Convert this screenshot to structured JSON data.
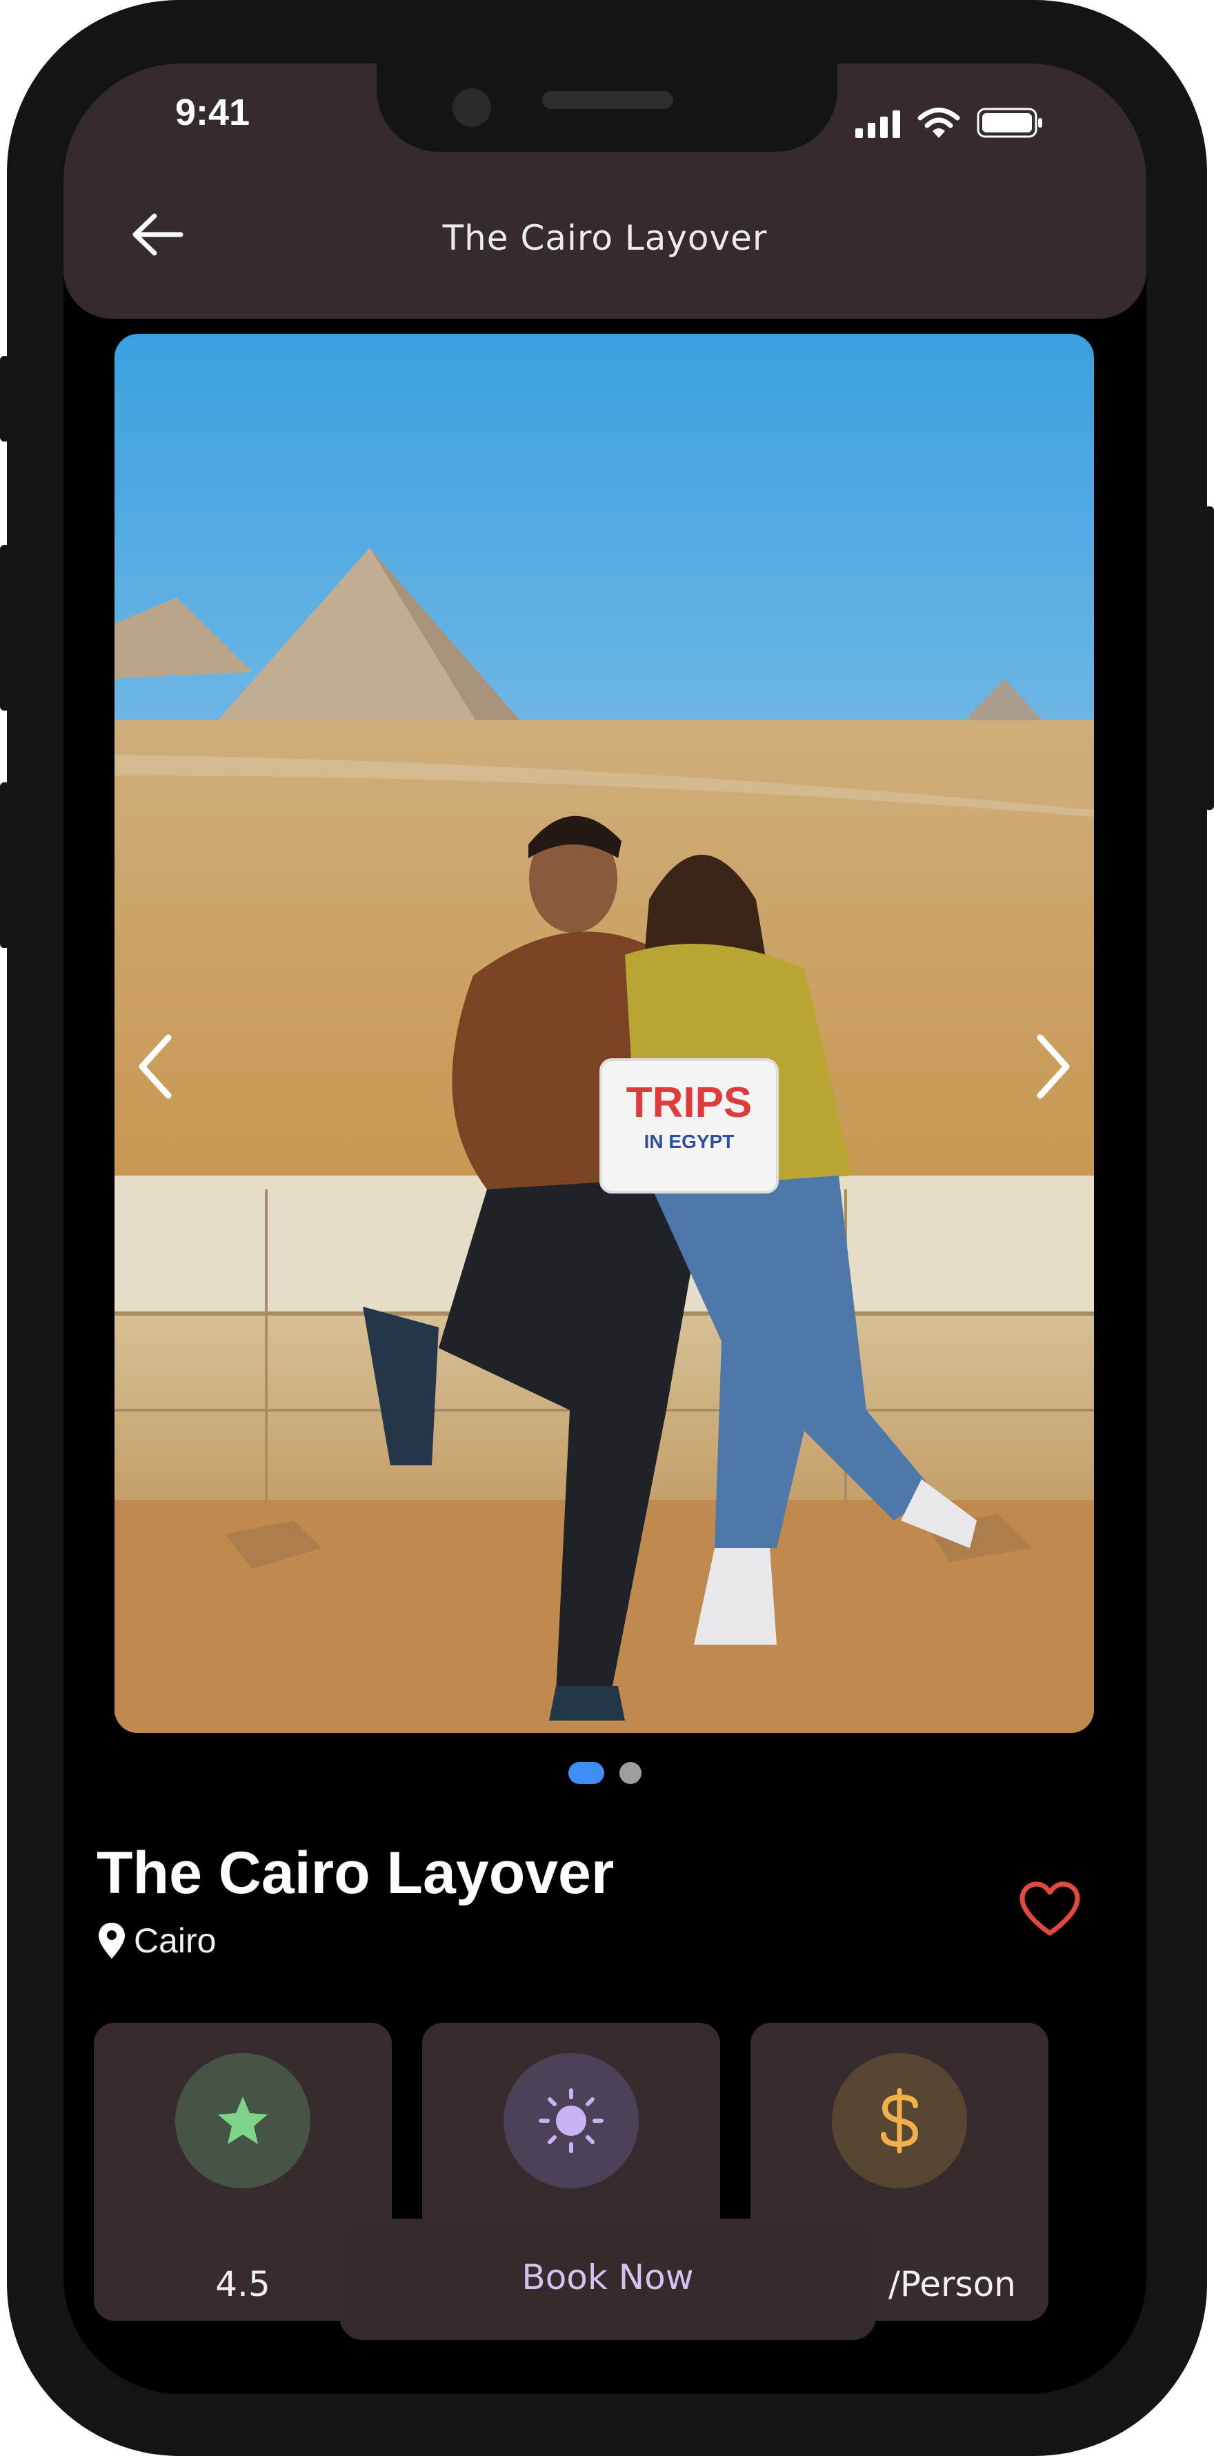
{
  "status_bar": {
    "time": "9:41",
    "icons": [
      "signal-icon",
      "wifi-icon",
      "battery-icon"
    ]
  },
  "app_bar": {
    "title": "The Cairo Layover",
    "back_icon": "arrow-left-icon"
  },
  "gallery": {
    "image": "Couple seated on a stone ledge in front of the Giza pyramids holding a sign",
    "sign_text": {
      "line1": "TRIPS",
      "line2": "IN EGYPT"
    },
    "total_images": 2,
    "active_index": 0,
    "prev_icon": "chevron-left-icon",
    "next_icon": "chevron-right-icon"
  },
  "tour": {
    "title": "The Cairo Layover",
    "location": "Cairo",
    "location_icon": "map-pin-icon",
    "favorite_icon": "heart-outline-icon"
  },
  "info_cards": [
    {
      "icon": "star-icon",
      "label": "4.5"
    },
    {
      "icon": "sun-icon",
      "label": ""
    },
    {
      "icon": "dollar-icon",
      "label": "/Person"
    }
  ],
  "book_button": {
    "label": "Book Now"
  },
  "colors": {
    "app_bar": "#352a2c",
    "card": "#362b2d",
    "dot_active": "#3f8ef7",
    "dot_inactive": "#9e9e9e",
    "favorite": "#e5483f",
    "star": "#7fd48c",
    "sun": "#c9b3f5",
    "dollar": "#f0b04a",
    "book_text": "#d5c2f0"
  }
}
